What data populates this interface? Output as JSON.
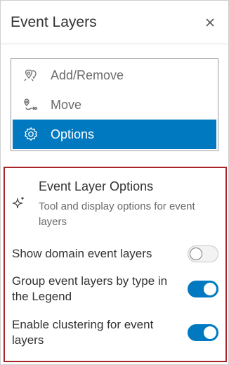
{
  "header": {
    "title": "Event Layers",
    "close_icon": "close-icon"
  },
  "menu": {
    "items": [
      {
        "label": "Add/Remove",
        "icon": "add-remove-layers-icon",
        "active": false
      },
      {
        "label": "Move",
        "icon": "move-icon",
        "active": false
      },
      {
        "label": "Options",
        "icon": "gear-icon",
        "active": true
      }
    ]
  },
  "options": {
    "icon": "sparkle-icon",
    "title": "Event Layer Options",
    "description": "Tool and display options for event layers",
    "toggles": [
      {
        "label": "Show domain event layers",
        "on": false
      },
      {
        "label": "Group event layers by type in the Legend",
        "on": true
      },
      {
        "label": "Enable clustering for event layers",
        "on": true
      }
    ]
  },
  "colors": {
    "accent": "#0079c1",
    "highlight_border": "#a8252b"
  }
}
